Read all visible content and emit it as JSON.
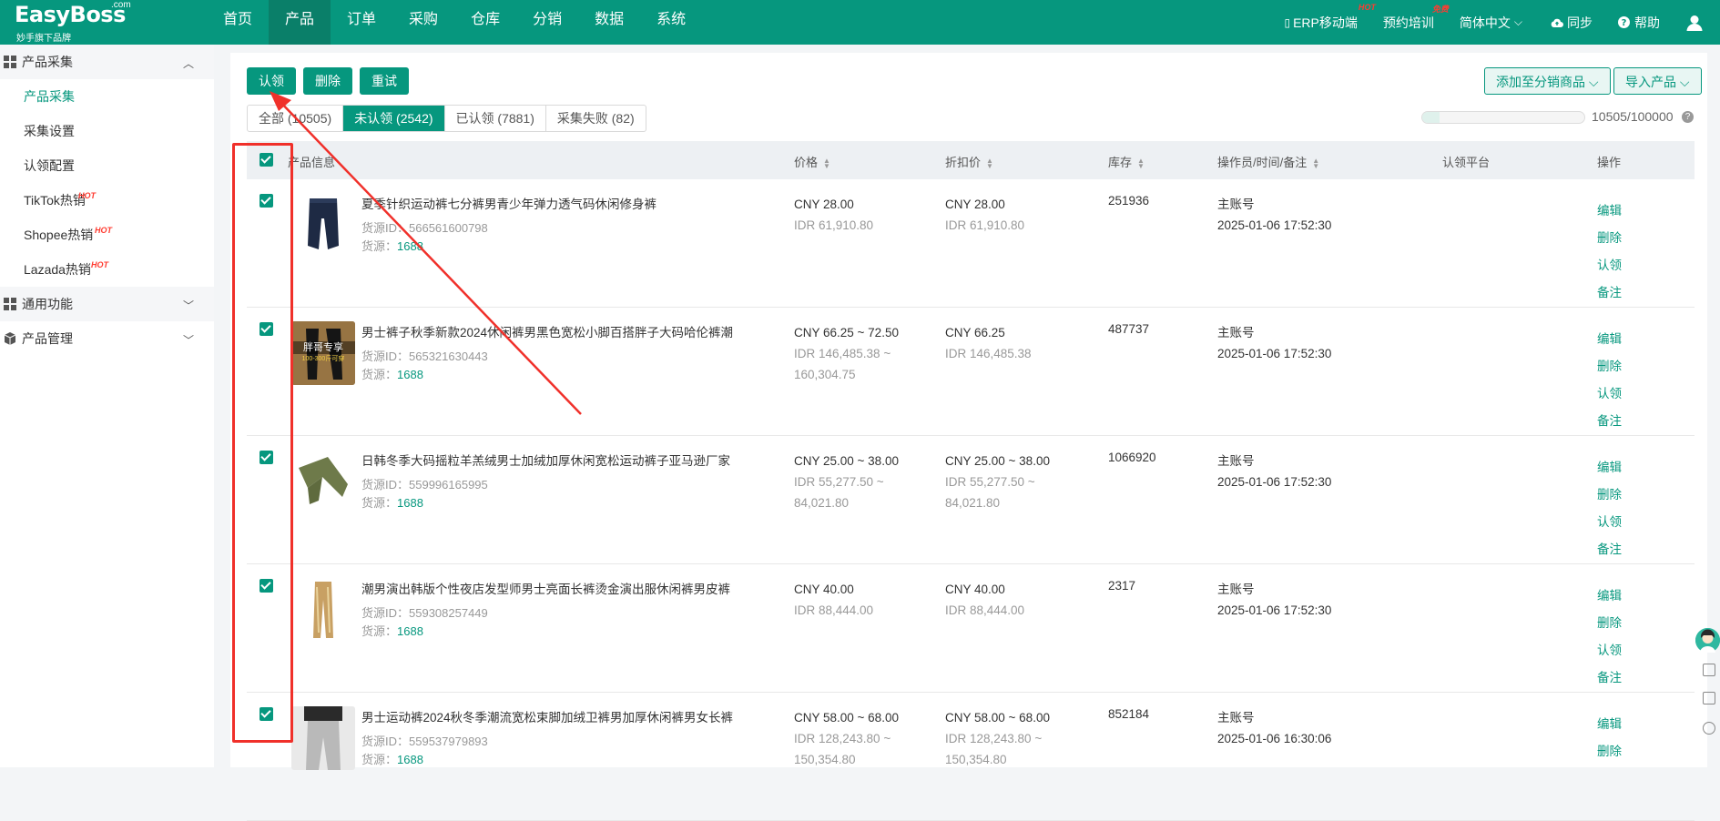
{
  "topbar": {
    "brand": "EasyBoss",
    "brand_com": ".com",
    "brand_sub": "妙手旗下品牌",
    "nav": [
      "首页",
      "产品",
      "订单",
      "采购",
      "仓库",
      "分销",
      "数据",
      "系统"
    ],
    "right": {
      "erp": "ERP移动端",
      "erp_badge": "HOT",
      "train": "预约培训",
      "train_badge": "免费",
      "lang": "简体中文",
      "sync": "同步",
      "help": "帮助"
    }
  },
  "sidebar": {
    "group1": "产品采集",
    "items": [
      "产品采集",
      "采集设置",
      "认领配置",
      "TikTok热销",
      "Shopee热销",
      "Lazada热销"
    ],
    "hot_badge": "HOT",
    "group2": "通用功能",
    "group3": "产品管理"
  },
  "toolbar": {
    "claim": "认领",
    "delete": "删除",
    "retry": "重试",
    "add_dist": "添加至分销商品",
    "import": "导入产品"
  },
  "tabs": [
    "全部 (10505)",
    "未认领 (2542)",
    "已认领 (7881)",
    "采集失败 (82)"
  ],
  "quota": {
    "text": "10505/100000",
    "used": 10505,
    "total": 100000
  },
  "table": {
    "headers": {
      "product": "产品信息",
      "price": "价格",
      "discount": "折扣价",
      "stock": "库存",
      "operator": "操作员/时间/备注",
      "platform": "认领平台",
      "actions": "操作"
    },
    "action_labels": [
      "编辑",
      "删除",
      "认领",
      "备注"
    ],
    "rows": [
      {
        "title": "夏季针织运动裤七分裤男青少年弹力透气码休闲修身裤",
        "srcid": "货源ID：566561600798",
        "src_label": "货源：",
        "src_value": "1688",
        "price_cny": "CNY 28.00",
        "price_idr": "IDR 61,910.80",
        "price_idr2": "",
        "disc_cny": "CNY 28.00",
        "disc_idr": "IDR 61,910.80",
        "disc_idr2": "",
        "stock": "251936",
        "operator": "主账号",
        "time": "2025-01-06 17:52:30"
      },
      {
        "title": "男士裤子秋季新款2024休闲裤男黑色宽松小脚百搭胖子大码哈伦裤潮",
        "srcid": "货源ID：565321630443",
        "src_label": "货源：",
        "src_value": "1688",
        "thumb_text": "胖哥专享",
        "thumb_subtext": "100-300斤可穿",
        "price_cny": "CNY 66.25 ~ 72.50",
        "price_idr": "IDR 146,485.38 ~",
        "price_idr2": "160,304.75",
        "disc_cny": "CNY 66.25",
        "disc_idr": "IDR 146,485.38",
        "disc_idr2": "",
        "stock": "487737",
        "operator": "主账号",
        "time": "2025-01-06 17:52:30"
      },
      {
        "title": "日韩冬季大码摇粒羊羔绒男士加绒加厚休闲宽松运动裤子亚马逊厂家",
        "srcid": "货源ID：559996165995",
        "src_label": "货源：",
        "src_value": "1688",
        "price_cny": "CNY 25.00 ~ 38.00",
        "price_idr": "IDR 55,277.50 ~",
        "price_idr2": "84,021.80",
        "disc_cny": "CNY 25.00 ~ 38.00",
        "disc_idr": "IDR 55,277.50 ~",
        "disc_idr2": "84,021.80",
        "stock": "1066920",
        "operator": "主账号",
        "time": "2025-01-06 17:52:30"
      },
      {
        "title": "潮男演出韩版个性夜店发型师男士亮面长裤烫金演出服休闲裤男皮裤",
        "srcid": "货源ID：559308257449",
        "src_label": "货源：",
        "src_value": "1688",
        "price_cny": "CNY 40.00",
        "price_idr": "IDR 88,444.00",
        "price_idr2": "",
        "disc_cny": "CNY 40.00",
        "disc_idr": "IDR 88,444.00",
        "disc_idr2": "",
        "stock": "2317",
        "operator": "主账号",
        "time": "2025-01-06 17:52:30"
      },
      {
        "title": "男士运动裤2024秋冬季潮流宽松束脚加绒卫裤男加厚休闲裤男女长裤",
        "srcid": "货源ID：559537979893",
        "src_label": "货源：",
        "src_value": "1688",
        "price_cny": "CNY 58.00 ~ 68.00",
        "price_idr": "IDR 128,243.80 ~",
        "price_idr2": "150,354.80",
        "disc_cny": "CNY 58.00 ~ 68.00",
        "disc_idr": "IDR 128,243.80 ~",
        "disc_idr2": "150,354.80",
        "stock": "852184",
        "operator": "主账号",
        "time": "2025-01-06 16:30:06"
      }
    ]
  },
  "colors": {
    "primary": "#06977e",
    "annotation": "#f0302a"
  }
}
